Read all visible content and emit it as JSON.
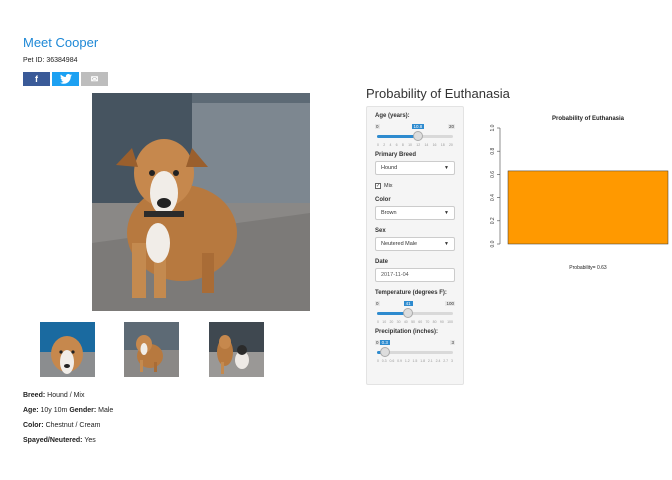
{
  "pet": {
    "name": "Meet Cooper",
    "pet_id": "Pet ID: 36384984",
    "breed_label": "Breed:",
    "breed": "Hound / Mix",
    "age_label": "Age:",
    "age": "10y 10m",
    "gender_label": "Gender:",
    "gender": "Male",
    "color_label": "Color:",
    "color": "Chestnut / Cream",
    "spayed_label": "Spayed/Neutered:",
    "spayed": "Yes"
  },
  "share": {
    "facebook": "f",
    "twitter": "t",
    "email": "✉"
  },
  "probability": {
    "title": "Probability of Euthanasia"
  },
  "controls": {
    "age": {
      "label": "Age (years):",
      "min": "0",
      "max": "20",
      "value": "10.8",
      "fraction": 0.54,
      "ticks": [
        "0",
        "2",
        "4",
        "6",
        "8",
        "10",
        "12",
        "14",
        "16",
        "18",
        "20"
      ]
    },
    "breed": {
      "label": "Primary Breed",
      "value": "Hound"
    },
    "mix": {
      "label": "Mix",
      "checked": "✓"
    },
    "color": {
      "label": "Color",
      "value": "Brown"
    },
    "sex": {
      "label": "Sex",
      "value": "Neutered Male"
    },
    "date": {
      "label": "Date",
      "value": "2017-11-04"
    },
    "temp": {
      "label": "Temperature (degrees F):",
      "min": "0",
      "max": "100",
      "value": "41",
      "fraction": 0.41,
      "ticks": [
        "0",
        "10",
        "20",
        "30",
        "40",
        "50",
        "60",
        "70",
        "80",
        "90",
        "100"
      ]
    },
    "precip": {
      "label": "Precipitation (inches):",
      "min": "0",
      "max": "3",
      "value": "0.3",
      "fraction": 0.1,
      "ticks": [
        "0",
        "0.3",
        "0.6",
        "0.9",
        "1.2",
        "1.5",
        "1.8",
        "2.1",
        "2.4",
        "2.7",
        "3"
      ]
    }
  },
  "chart_data": {
    "type": "bar",
    "title": "Probability of Euthanasia",
    "categories": [
      ""
    ],
    "values": [
      0.63
    ],
    "ylim": [
      0,
      1
    ],
    "yticks": [
      "0.0",
      "0.2",
      "0.4",
      "0.6",
      "0.8",
      "1.0"
    ],
    "xlabel": "Probability= 0.63",
    "bar_color": "#ff9900"
  }
}
